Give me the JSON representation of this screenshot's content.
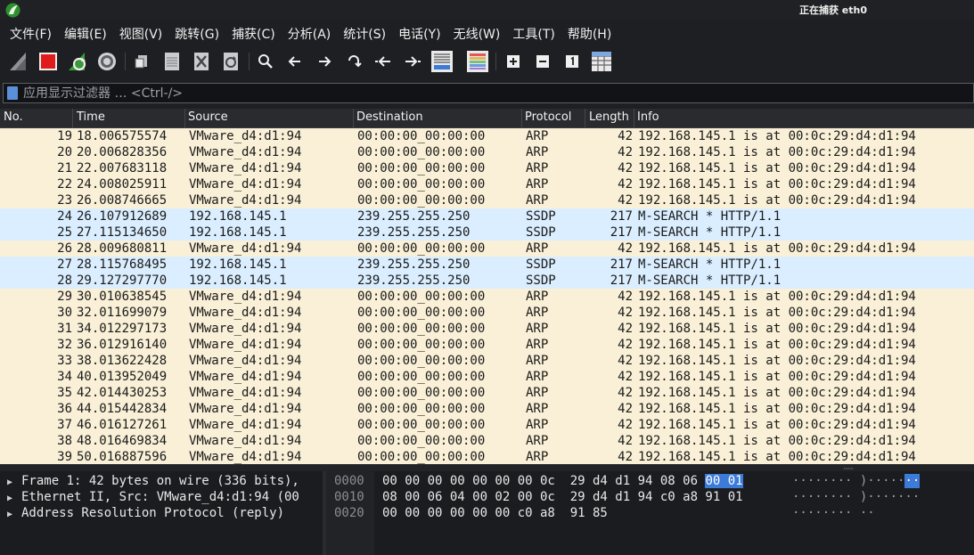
{
  "window": {
    "title": "正在捕获 eth0"
  },
  "menu": [
    "文件(F)",
    "编辑(E)",
    "视图(V)",
    "跳转(G)",
    "捕获(C)",
    "分析(A)",
    "统计(S)",
    "电话(Y)",
    "无线(W)",
    "工具(T)",
    "帮助(H)"
  ],
  "toolbar": {
    "icons": [
      "shark-fin-start-icon",
      "stop-capture-icon",
      "restart-capture-icon",
      "capture-options-icon",
      "open-file-icon",
      "save-file-icon",
      "close-file-icon",
      "reload-file-icon",
      "search-icon",
      "go-back-icon",
      "go-forward-icon",
      "go-to-packet-icon",
      "first-packet-icon",
      "last-packet-icon",
      "autoscroll-icon",
      "colorize-icon",
      "zoom-in-icon",
      "zoom-out-icon",
      "normal-size-icon",
      "resize-columns-icon"
    ]
  },
  "filter": {
    "placeholder": "应用显示过滤器 … <Ctrl-/>"
  },
  "columns": {
    "no": "No.",
    "time": "Time",
    "source": "Source",
    "destination": "Destination",
    "protocol": "Protocol",
    "length": "Length",
    "info": "Info"
  },
  "packets": [
    {
      "no": "19",
      "time": "18.006575574",
      "source": "VMware_d4:d1:94",
      "destination": "00:00:00_00:00:00",
      "protocol": "ARP",
      "length": "42",
      "info": "192.168.145.1 is at 00:0c:29:d4:d1:94",
      "color": "arp"
    },
    {
      "no": "20",
      "time": "20.006828356",
      "source": "VMware_d4:d1:94",
      "destination": "00:00:00_00:00:00",
      "protocol": "ARP",
      "length": "42",
      "info": "192.168.145.1 is at 00:0c:29:d4:d1:94",
      "color": "arp"
    },
    {
      "no": "21",
      "time": "22.007683118",
      "source": "VMware_d4:d1:94",
      "destination": "00:00:00_00:00:00",
      "protocol": "ARP",
      "length": "42",
      "info": "192.168.145.1 is at 00:0c:29:d4:d1:94",
      "color": "arp"
    },
    {
      "no": "22",
      "time": "24.008025911",
      "source": "VMware_d4:d1:94",
      "destination": "00:00:00_00:00:00",
      "protocol": "ARP",
      "length": "42",
      "info": "192.168.145.1 is at 00:0c:29:d4:d1:94",
      "color": "arp"
    },
    {
      "no": "23",
      "time": "26.008746665",
      "source": "VMware_d4:d1:94",
      "destination": "00:00:00_00:00:00",
      "protocol": "ARP",
      "length": "42",
      "info": "192.168.145.1 is at 00:0c:29:d4:d1:94",
      "color": "arp"
    },
    {
      "no": "24",
      "time": "26.107912689",
      "source": "192.168.145.1",
      "destination": "239.255.255.250",
      "protocol": "SSDP",
      "length": "217",
      "info": "M-SEARCH * HTTP/1.1",
      "color": "ssdp"
    },
    {
      "no": "25",
      "time": "27.115134650",
      "source": "192.168.145.1",
      "destination": "239.255.255.250",
      "protocol": "SSDP",
      "length": "217",
      "info": "M-SEARCH * HTTP/1.1",
      "color": "ssdp"
    },
    {
      "no": "26",
      "time": "28.009680811",
      "source": "VMware_d4:d1:94",
      "destination": "00:00:00_00:00:00",
      "protocol": "ARP",
      "length": "42",
      "info": "192.168.145.1 is at 00:0c:29:d4:d1:94",
      "color": "arp"
    },
    {
      "no": "27",
      "time": "28.115768495",
      "source": "192.168.145.1",
      "destination": "239.255.255.250",
      "protocol": "SSDP",
      "length": "217",
      "info": "M-SEARCH * HTTP/1.1",
      "color": "ssdp"
    },
    {
      "no": "28",
      "time": "29.127297770",
      "source": "192.168.145.1",
      "destination": "239.255.255.250",
      "protocol": "SSDP",
      "length": "217",
      "info": "M-SEARCH * HTTP/1.1",
      "color": "ssdp"
    },
    {
      "no": "29",
      "time": "30.010638545",
      "source": "VMware_d4:d1:94",
      "destination": "00:00:00_00:00:00",
      "protocol": "ARP",
      "length": "42",
      "info": "192.168.145.1 is at 00:0c:29:d4:d1:94",
      "color": "arp"
    },
    {
      "no": "30",
      "time": "32.011699079",
      "source": "VMware_d4:d1:94",
      "destination": "00:00:00_00:00:00",
      "protocol": "ARP",
      "length": "42",
      "info": "192.168.145.1 is at 00:0c:29:d4:d1:94",
      "color": "arp"
    },
    {
      "no": "31",
      "time": "34.012297173",
      "source": "VMware_d4:d1:94",
      "destination": "00:00:00_00:00:00",
      "protocol": "ARP",
      "length": "42",
      "info": "192.168.145.1 is at 00:0c:29:d4:d1:94",
      "color": "arp"
    },
    {
      "no": "32",
      "time": "36.012916140",
      "source": "VMware_d4:d1:94",
      "destination": "00:00:00_00:00:00",
      "protocol": "ARP",
      "length": "42",
      "info": "192.168.145.1 is at 00:0c:29:d4:d1:94",
      "color": "arp"
    },
    {
      "no": "33",
      "time": "38.013622428",
      "source": "VMware_d4:d1:94",
      "destination": "00:00:00_00:00:00",
      "protocol": "ARP",
      "length": "42",
      "info": "192.168.145.1 is at 00:0c:29:d4:d1:94",
      "color": "arp"
    },
    {
      "no": "34",
      "time": "40.013952049",
      "source": "VMware_d4:d1:94",
      "destination": "00:00:00_00:00:00",
      "protocol": "ARP",
      "length": "42",
      "info": "192.168.145.1 is at 00:0c:29:d4:d1:94",
      "color": "arp"
    },
    {
      "no": "35",
      "time": "42.014430253",
      "source": "VMware_d4:d1:94",
      "destination": "00:00:00_00:00:00",
      "protocol": "ARP",
      "length": "42",
      "info": "192.168.145.1 is at 00:0c:29:d4:d1:94",
      "color": "arp"
    },
    {
      "no": "36",
      "time": "44.015442834",
      "source": "VMware_d4:d1:94",
      "destination": "00:00:00_00:00:00",
      "protocol": "ARP",
      "length": "42",
      "info": "192.168.145.1 is at 00:0c:29:d4:d1:94",
      "color": "arp"
    },
    {
      "no": "37",
      "time": "46.016127261",
      "source": "VMware_d4:d1:94",
      "destination": "00:00:00_00:00:00",
      "protocol": "ARP",
      "length": "42",
      "info": "192.168.145.1 is at 00:0c:29:d4:d1:94",
      "color": "arp"
    },
    {
      "no": "38",
      "time": "48.016469834",
      "source": "VMware_d4:d1:94",
      "destination": "00:00:00_00:00:00",
      "protocol": "ARP",
      "length": "42",
      "info": "192.168.145.1 is at 00:0c:29:d4:d1:94",
      "color": "arp"
    },
    {
      "no": "39",
      "time": "50.016887596",
      "source": "VMware_d4:d1:94",
      "destination": "00:00:00_00:00:00",
      "protocol": "ARP",
      "length": "42",
      "info": "192.168.145.1 is at 00:0c:29:d4:d1:94",
      "color": "arp"
    }
  ],
  "details": [
    "Frame 1: 42 bytes on wire (336 bits),",
    "Ethernet II, Src: VMware_d4:d1:94 (00",
    "Address Resolution Protocol (reply)"
  ],
  "bytes": [
    {
      "offset": "0000",
      "hex_pre": "00 00 00 00 00 00 00 0c  29 d4 d1 94 08 06 ",
      "hex_hl": "00 01",
      "ascii_pre": "········ )·····",
      "ascii_hl": "··"
    },
    {
      "offset": "0010",
      "hex_pre": "08 00 06 04 00 02 00 0c  29 d4 d1 94 c0 a8 91 01",
      "hex_hl": "",
      "ascii_pre": "········ )·······",
      "ascii_hl": ""
    },
    {
      "offset": "0020",
      "hex_pre": "00 00 00 00 00 00 c0 a8  91 85",
      "hex_hl": "",
      "ascii_pre": "········ ··",
      "ascii_hl": ""
    }
  ],
  "colors": {
    "arp_row": "#faf0d7",
    "ssdp_row": "#daeeff",
    "byte_highlight": "#3d7bd9",
    "stop_red": "#e01b1b",
    "shark_green": "#3a9a3a"
  }
}
